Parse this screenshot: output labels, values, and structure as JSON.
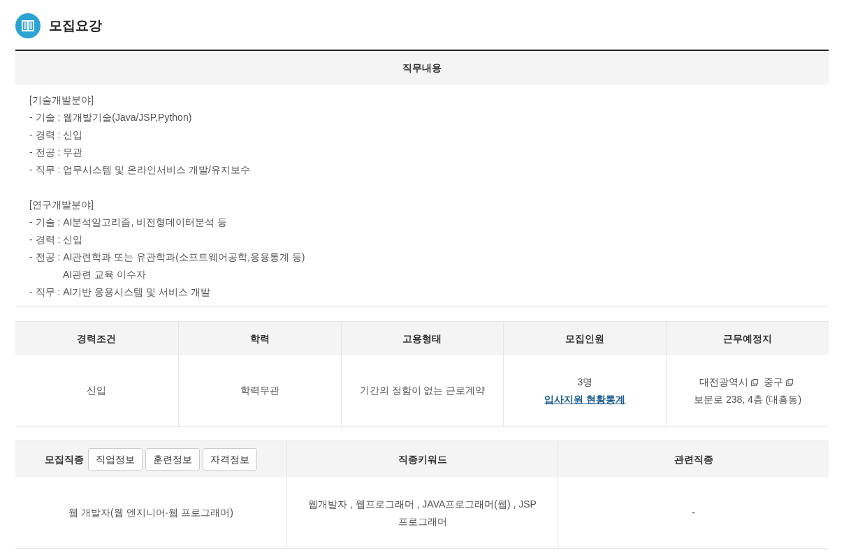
{
  "title": "모집요강",
  "job_description": {
    "header": "직무내용",
    "sections": [
      {
        "heading": "[기술개발분야]",
        "lines": [
          {
            "kind": "item",
            "text": "- 기술 : 웹개발기술(Java/JSP,Python)"
          },
          {
            "kind": "item",
            "text": "- 경력 : 신입"
          },
          {
            "kind": "item",
            "text": "- 전공 : 무관"
          },
          {
            "kind": "item",
            "text": "- 직무 : 업무시스템 및 온라인서비스 개발/유지보수"
          }
        ]
      },
      {
        "heading": "[연구개발분야]",
        "lines": [
          {
            "kind": "item",
            "text": "- 기술 : AI분석알고리즘, 비전형데이터분석 등"
          },
          {
            "kind": "item",
            "text": "- 경력 : 신입"
          },
          {
            "kind": "item",
            "text": "- 전공 : AI관련학과 또는 유관학과(소프트웨어공학,응용통계 등)"
          },
          {
            "kind": "continuation",
            "text": "AI관련 교육 이수자"
          },
          {
            "kind": "item",
            "text": "- 직무 : AI기반 응용시스템 및 서비스 개발"
          }
        ]
      }
    ]
  },
  "conditions": {
    "columns": [
      "경력조건",
      "학력",
      "고용형태",
      "모집인원",
      "근무예정지"
    ],
    "experience": "신입",
    "education": "학력무관",
    "employment": "기간의 정함이 없는 근로계약",
    "headcount": "3명",
    "stats_link": "입사지원 현황통계",
    "location": [
      {
        "text": "대전광역시",
        "link_icon": true
      },
      {
        "text": "중구",
        "link_icon": true
      },
      {
        "text": "보문로 238, 4층 (대흥동)",
        "link_icon": false
      }
    ]
  },
  "occupation": {
    "label": "모집직종",
    "buttons": [
      "직업정보",
      "훈련정보",
      "자격정보"
    ],
    "columns": [
      "직종키워드",
      "관련직종"
    ],
    "job": "웹 개발자(웹 엔지니어·웹 프로그래머)",
    "keywords": "웹개발자 , 웹프로그래머 , JAVA프로그래머(웹) , JSP프로그래머",
    "related": "-"
  }
}
